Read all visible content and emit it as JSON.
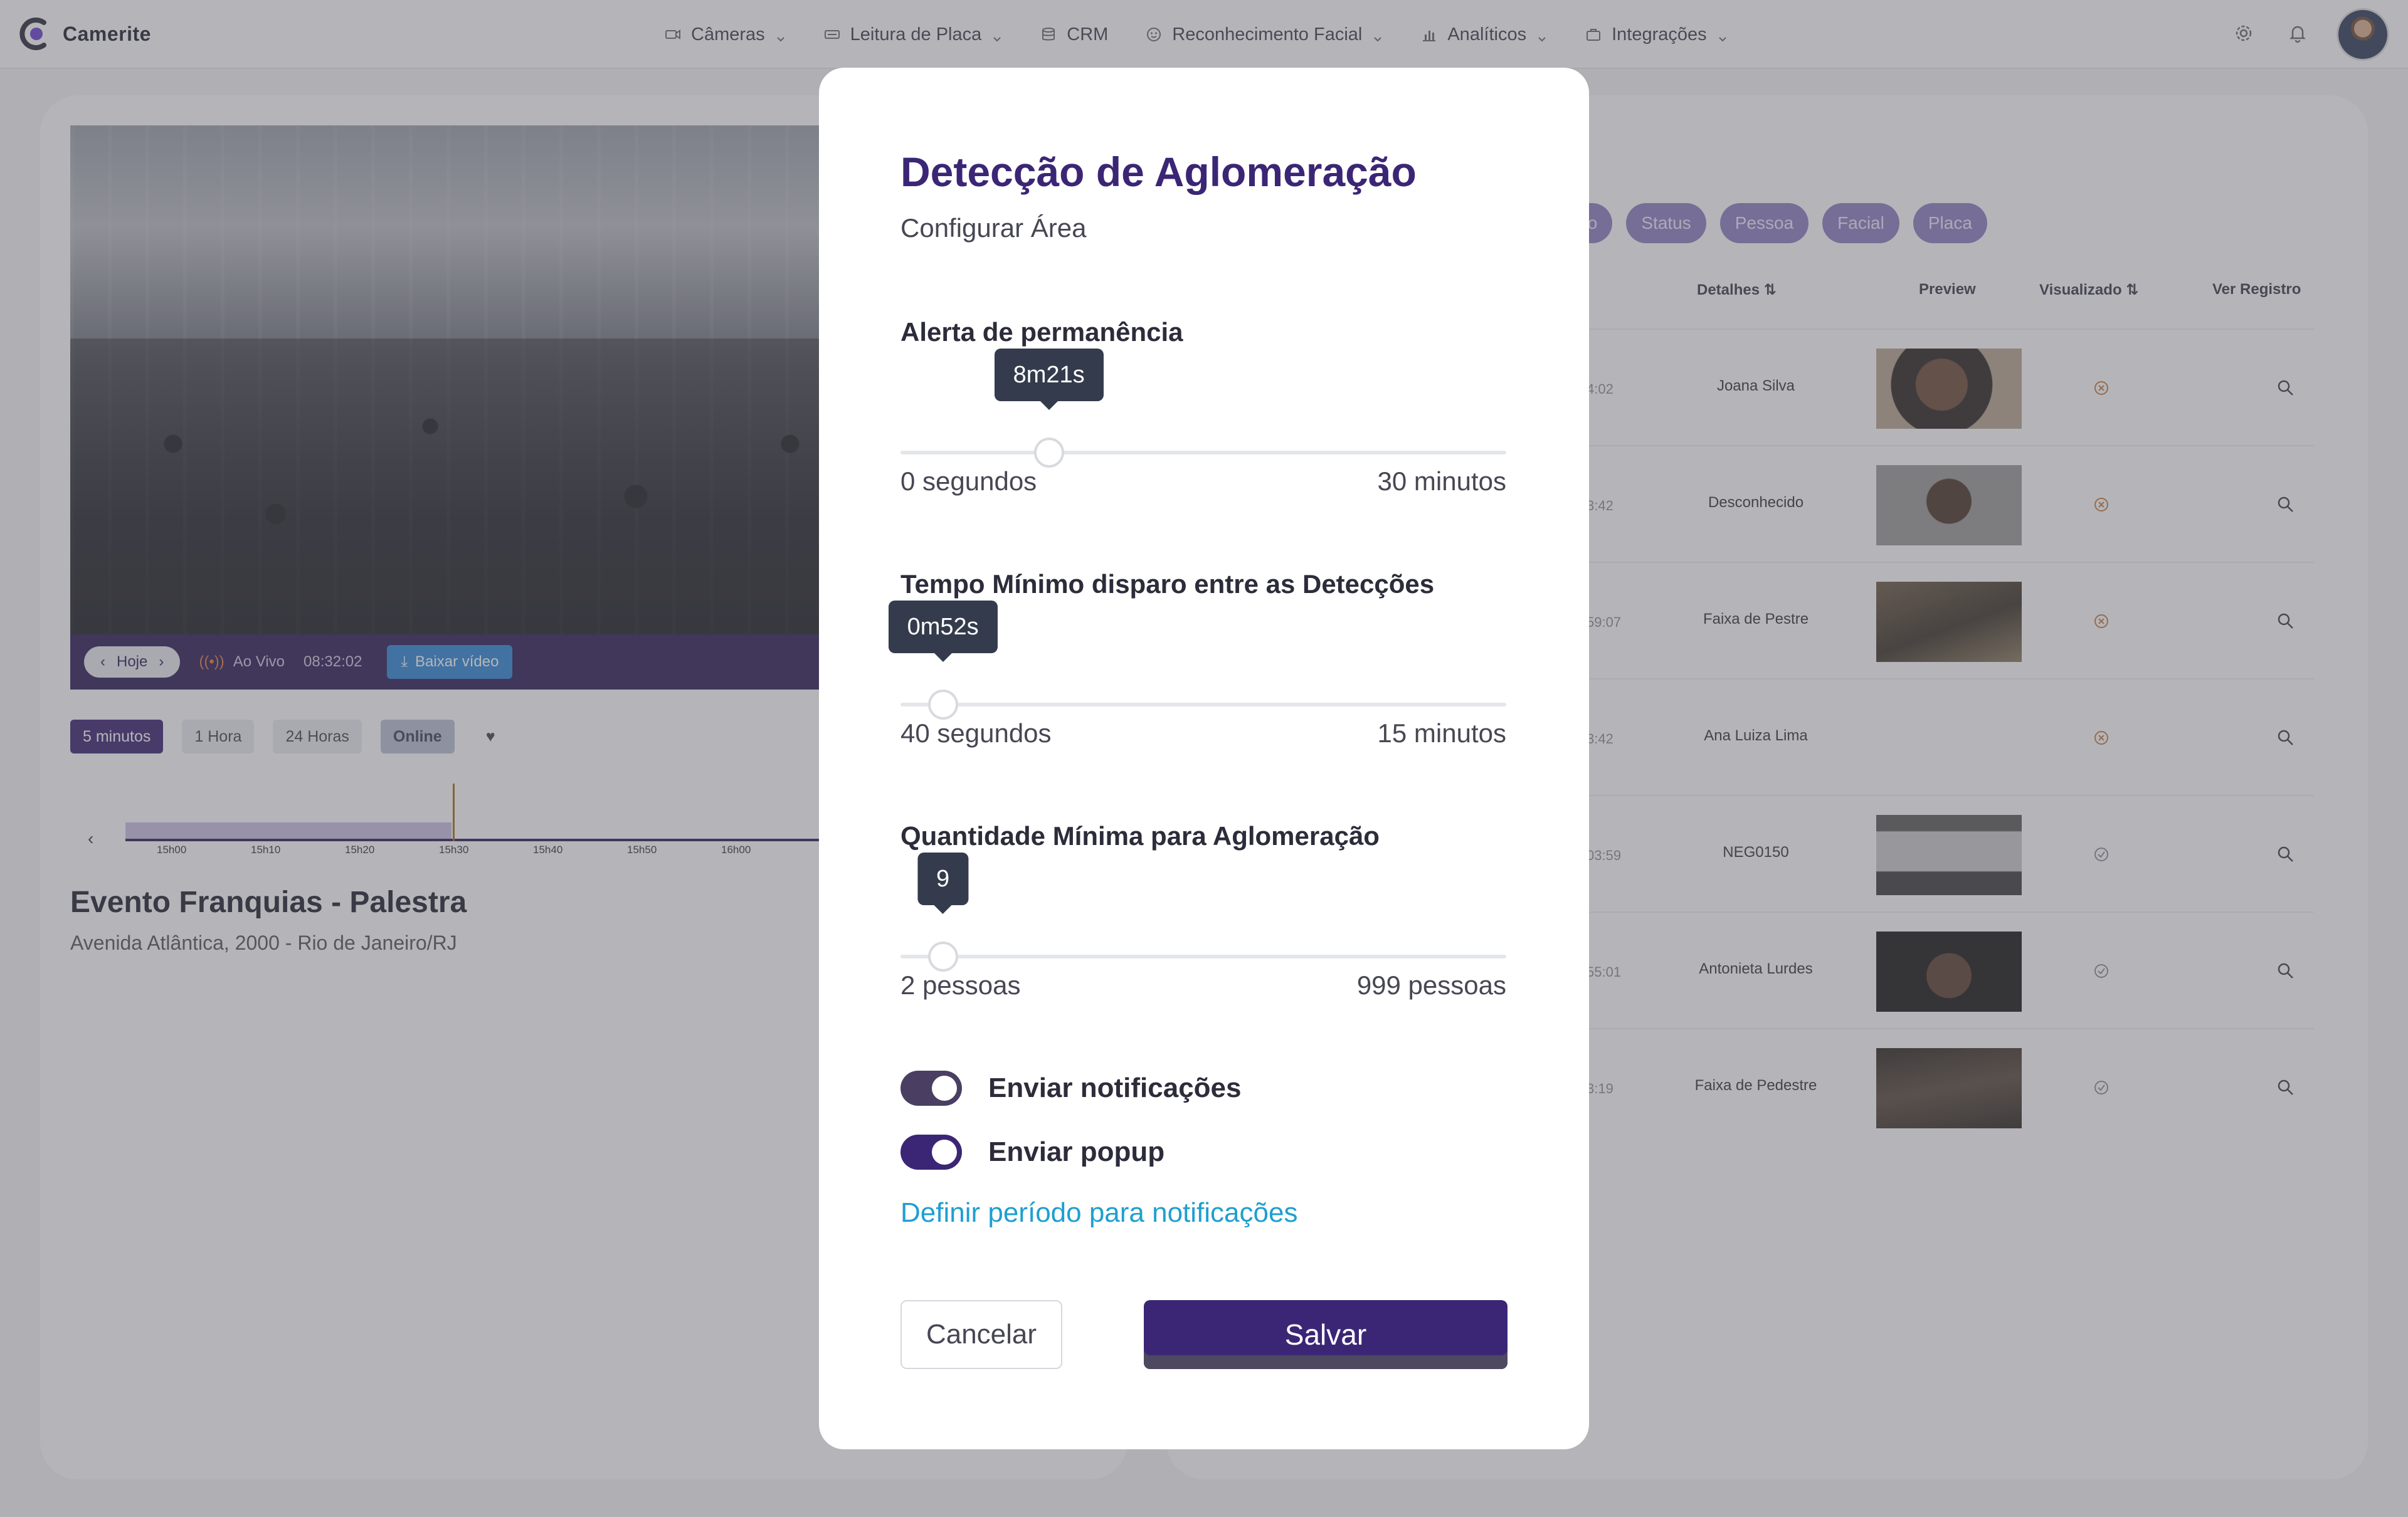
{
  "app": {
    "name": "Camerite"
  },
  "nav": {
    "items": [
      {
        "label": "Câmeras",
        "icon": "camera-icon",
        "dropdown": true
      },
      {
        "label": "Leitura de Placa",
        "icon": "plate-icon",
        "dropdown": true
      },
      {
        "label": "CRM",
        "icon": "database-icon",
        "dropdown": false
      },
      {
        "label": "Reconhecimento Facial",
        "icon": "face-icon",
        "dropdown": true
      },
      {
        "label": "Analíticos",
        "icon": "chart-icon",
        "dropdown": true
      },
      {
        "label": "Integrações",
        "icon": "briefcase-icon",
        "dropdown": true
      }
    ]
  },
  "player": {
    "day_label": "Hoje",
    "live_label": "Ao Vivo",
    "time": "08:32:02",
    "download_label": "Baixar vídeo",
    "ranges": [
      "5 minutos",
      "1 Hora",
      "24 Horas",
      "Online"
    ],
    "active_range": "5 minutos",
    "timeline_ticks": [
      "15h00",
      "15h10",
      "15h20",
      "15h30",
      "15h40",
      "15h50",
      "16h00"
    ]
  },
  "event": {
    "title": "Evento Franquias - Palestra",
    "address": "Avenida Atlântica, 2000 - Rio de Janeiro/RJ"
  },
  "records": {
    "filters": [
      "to",
      "Status",
      "Pessoa",
      "Facial",
      "Placa"
    ],
    "columns": {
      "details": "Detalhes",
      "preview": "Preview",
      "viewed": "Visualizado",
      "view_record": "Ver Registro"
    },
    "rows": [
      {
        "time": "4:02",
        "detail": "Joana Silva",
        "has_preview": true,
        "viewed": false
      },
      {
        "time": "3:42",
        "detail": "Desconhecido",
        "has_preview": true,
        "viewed": false
      },
      {
        "time": "59:07",
        "detail": "Faixa de Pestre",
        "has_preview": true,
        "viewed": false
      },
      {
        "time": "3:42",
        "detail": "Ana Luiza Lima",
        "has_preview": false,
        "viewed": false
      },
      {
        "time": "03:59",
        "detail": "NEG0150",
        "has_preview": true,
        "viewed": true
      },
      {
        "time": "55:01",
        "detail": "Antonieta Lurdes",
        "has_preview": true,
        "viewed": true
      },
      {
        "time": "3:19",
        "detail": "Faixa de Pedestre",
        "has_preview": true,
        "viewed": true
      }
    ]
  },
  "modal": {
    "title": "Detecção de Aglomeração",
    "subtitle": "Configurar Área",
    "sliders": [
      {
        "label": "Alerta de permanência",
        "value_label": "8m21s",
        "fraction": 0.245,
        "min_label": "0 segundos",
        "max_label": "30 minutos"
      },
      {
        "label": "Tempo Mínimo disparo entre as Detecções",
        "value_label": "0m52s",
        "fraction": 0.07,
        "min_label": "40 segundos",
        "max_label": "15 minutos"
      },
      {
        "label": "Quantidade Mínima para Aglomeração",
        "value_label": "9",
        "fraction": 0.07,
        "min_label": "2 pessoas",
        "max_label": "999 pessoas"
      }
    ],
    "toggles": [
      {
        "label": "Enviar notificações",
        "on": true
      },
      {
        "label": "Enviar popup",
        "on": true
      }
    ],
    "period_link": "Definir período para notificações",
    "cancel_label": "Cancelar",
    "save_label": "Salvar"
  },
  "colors": {
    "brand": "#3b2675",
    "link": "#1f9fd0",
    "tooltip": "#343b4c"
  }
}
